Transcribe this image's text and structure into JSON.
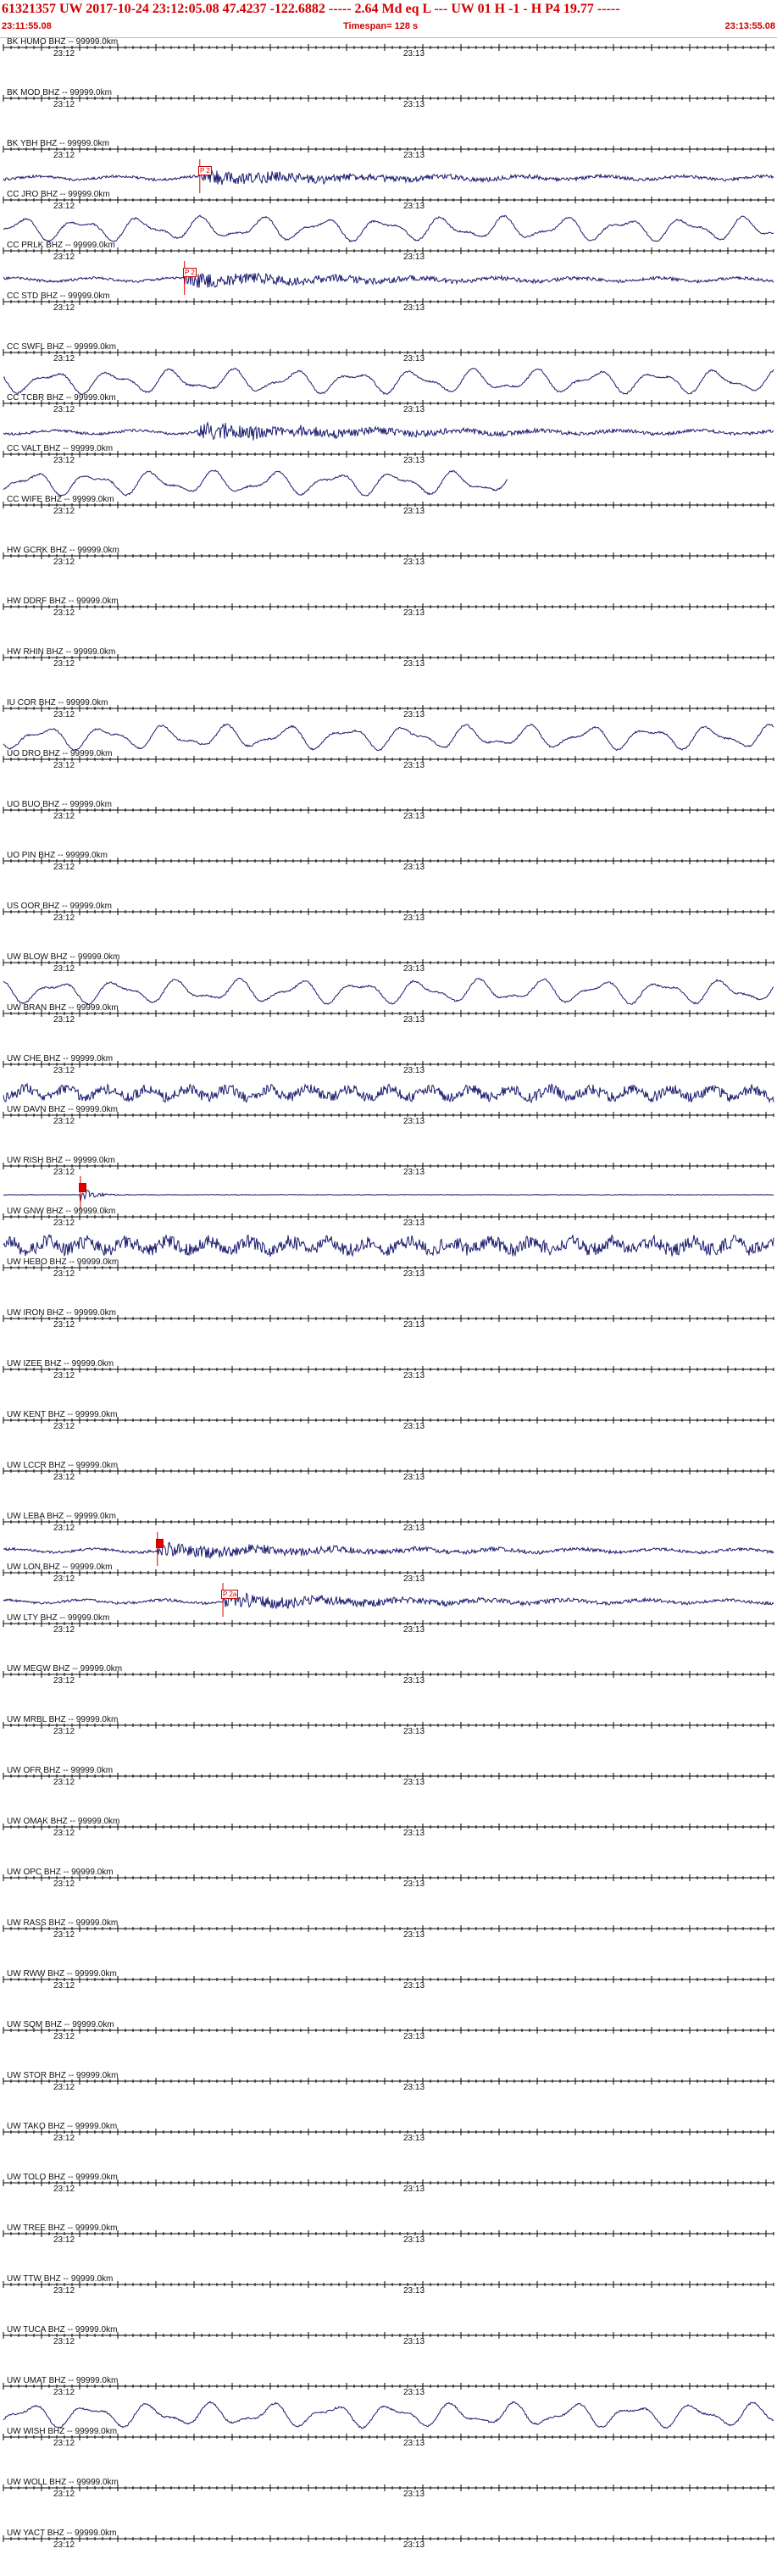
{
  "header": {
    "title": "61321357 UW 2017-10-24 23:12:05.08   47.4237 -122.6882 -----   2.64 Md  eq  L ---      UW 01  H  -1  -  H P4   19.77 -----",
    "start_time": "23:11:55.08",
    "timespan": "Timespan= 128 s",
    "end_time": "23:13:55.08"
  },
  "colors": {
    "header_text": "#d00000",
    "trace": "#1a1a6e",
    "pick": "#dd0000",
    "axis": "#000000"
  },
  "time_ticks": [
    "23:12",
    "23:13"
  ],
  "traces": [
    {
      "label": "BK HUMO BHZ -- 99999.0km",
      "kind": "flat"
    },
    {
      "label": "BK MOD BHZ -- 99999.0km",
      "kind": "flat"
    },
    {
      "label": "BK YBH BHZ -- 99999.0km",
      "kind": "quake",
      "pick": {
        "label": "P 2",
        "filled": false,
        "t": 0.255
      }
    },
    {
      "label": "CC JRO BHZ -- 99999.0km",
      "kind": "wave"
    },
    {
      "label": "CC PRLK BHZ -- 99999.0km",
      "kind": "quake",
      "pick": {
        "label": "P 2",
        "filled": false,
        "t": 0.235
      }
    },
    {
      "label": "CC STD BHZ -- 99999.0km",
      "kind": "flat"
    },
    {
      "label": "CC SWFL BHZ -- 99999.0km",
      "kind": "wave"
    },
    {
      "label": "CC TCBR BHZ -- 99999.0km",
      "kind": "quake2"
    },
    {
      "label": "CC VALT BHZ -- 99999.0km",
      "kind": "wave-partial"
    },
    {
      "label": "CC WIFE BHZ -- 99999.0km",
      "kind": "flat"
    },
    {
      "label": "HW GCRK BHZ -- 99999.0km",
      "kind": "flat"
    },
    {
      "label": "HW DDRF BHZ -- 99999.0km",
      "kind": "flat"
    },
    {
      "label": "HW RHIN BHZ -- 99999.0km",
      "kind": "flat"
    },
    {
      "label": "IU COR BHZ -- 99999.0km",
      "kind": "wave"
    },
    {
      "label": "UO DRO BHZ -- 99999.0km",
      "kind": "flat"
    },
    {
      "label": "UO BUO BHZ -- 99999.0km",
      "kind": "flat"
    },
    {
      "label": "UO PIN BHZ -- 99999.0km",
      "kind": "flat"
    },
    {
      "label": "US OOR BHZ -- 99999.0km",
      "kind": "flat"
    },
    {
      "label": "UW BLOW BHZ -- 99999.0km",
      "kind": "wave"
    },
    {
      "label": "UW BRAN BHZ -- 99999.0km",
      "kind": "flat"
    },
    {
      "label": "UW CHE BHZ -- 99999.0km",
      "kind": "noise"
    },
    {
      "label": "UW DAVN BHZ -- 99999.0km",
      "kind": "flat"
    },
    {
      "label": "UW RISH BHZ -- 99999.0km",
      "kind": "spike",
      "pick": {
        "label": "P",
        "filled": true,
        "t": 0.1
      }
    },
    {
      "label": "UW GNW BHZ -- 99999.0km",
      "kind": "noise2"
    },
    {
      "label": "UW HEBO BHZ -- 99999.0km",
      "kind": "flat"
    },
    {
      "label": "UW IRON BHZ -- 99999.0km",
      "kind": "flat"
    },
    {
      "label": "UW IZEE BHZ -- 99999.0km",
      "kind": "flat"
    },
    {
      "label": "UW KENT BHZ -- 99999.0km",
      "kind": "flat"
    },
    {
      "label": "UW LCCR BHZ -- 99999.0km",
      "kind": "flat"
    },
    {
      "label": "UW LEBA BHZ -- 99999.0km",
      "kind": "quake3",
      "pick": {
        "label": "P",
        "filled": true,
        "t": 0.2
      }
    },
    {
      "label": "UW LON BHZ -- 99999.0km",
      "kind": "quake4",
      "pick": {
        "label": "P 2a",
        "filled": false,
        "t": 0.285
      }
    },
    {
      "label": "UW LTY BHZ -- 99999.0km",
      "kind": "flat"
    },
    {
      "label": "UW MEGW BHZ -- 99999.0km",
      "kind": "flat"
    },
    {
      "label": "UW MRBL BHZ -- 99999.0km",
      "kind": "flat"
    },
    {
      "label": "UW OFR BHZ -- 99999.0km",
      "kind": "flat"
    },
    {
      "label": "UW OMAK BHZ -- 99999.0km",
      "kind": "flat"
    },
    {
      "label": "UW OPC BHZ -- 99999.0km",
      "kind": "flat"
    },
    {
      "label": "UW RASS BHZ -- 99999.0km",
      "kind": "flat"
    },
    {
      "label": "UW RWW BHZ -- 99999.0km",
      "kind": "flat"
    },
    {
      "label": "UW SQM BHZ -- 99999.0km",
      "kind": "flat"
    },
    {
      "label": "UW STOR BHZ -- 99999.0km",
      "kind": "flat"
    },
    {
      "label": "UW TAKO BHZ -- 99999.0km",
      "kind": "flat"
    },
    {
      "label": "UW TOLO BHZ -- 99999.0km",
      "kind": "flat"
    },
    {
      "label": "UW TREE BHZ -- 99999.0km",
      "kind": "flat"
    },
    {
      "label": "UW TTW BHZ -- 99999.0km",
      "kind": "flat"
    },
    {
      "label": "UW TUCA BHZ -- 99999.0km",
      "kind": "flat"
    },
    {
      "label": "UW UMAT BHZ -- 99999.0km",
      "kind": "wave"
    },
    {
      "label": "UW WISH BHZ -- 99999.0km",
      "kind": "flat"
    },
    {
      "label": "UW WOLL BHZ -- 99999.0km",
      "kind": "flat"
    },
    {
      "label": "UW YACT BHZ -- 99999.0km",
      "kind": "flat"
    }
  ]
}
